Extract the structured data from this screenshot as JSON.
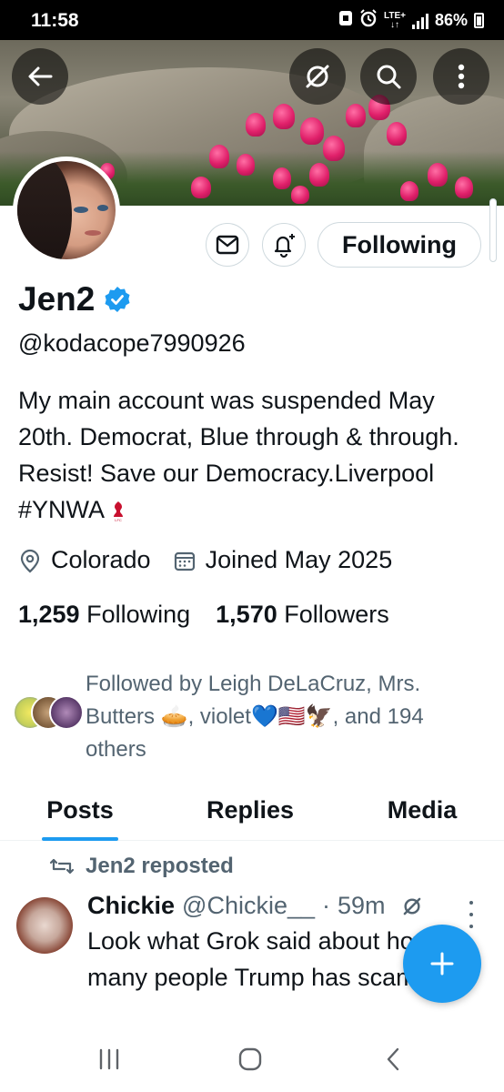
{
  "status_bar": {
    "time": "11:58",
    "network": "LTE+",
    "battery": "86%"
  },
  "profile": {
    "name": "Jen2",
    "handle": "@kodacope7990926",
    "bio": "My main account was suspended May 20th. Democrat, Blue through & through. Resist! Save our Democracy.Liverpool #YNWA",
    "location": "Colorado",
    "joined": "Joined May 2025",
    "following_count": "1,259",
    "following_label": "Following",
    "followers_count": "1,570",
    "followers_label": "Followers",
    "followed_by": "Followed by Leigh DeLaCruz, Mrs. Butters 🥧, violet💙🇺🇸🦅, and 194 others"
  },
  "actions": {
    "follow_state": "Following"
  },
  "tabs": [
    {
      "label": "Posts",
      "active": true
    },
    {
      "label": "Replies",
      "active": false
    },
    {
      "label": "Media",
      "active": false
    }
  ],
  "post": {
    "repost_label": "Jen2 reposted",
    "author_name": "Chickie",
    "author_handle": "@Chickie__",
    "separator": "·",
    "time": "59m",
    "text": "Look what Grok said about how many people Trump has scammed."
  },
  "colors": {
    "accent": "#1d9bf0",
    "verified": "#1d9bf0",
    "text": "#0f1419",
    "secondary": "#536471"
  },
  "icons": [
    "back-arrow-icon",
    "grok-icon",
    "search-icon",
    "more-vertical-icon",
    "mail-icon",
    "notification-bell-icon",
    "verified-badge-icon",
    "location-pin-icon",
    "calendar-icon",
    "repost-icon",
    "plus-icon"
  ]
}
